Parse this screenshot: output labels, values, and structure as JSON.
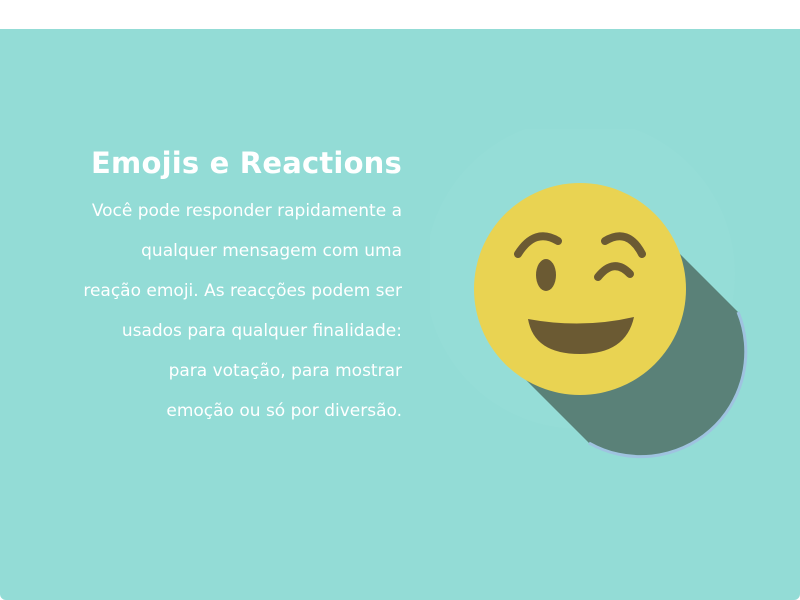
{
  "header": {
    "title": "Emojis e Reactions"
  },
  "description_lines": [
    "Você pode responder rapidamente a",
    "qualquer mensagem com uma",
    "reação emoji. As reacções podem ser",
    "usados para qualquer finalidade:",
    "para votação, para mostrar",
    "emoção ou só por diversão."
  ],
  "illustration": {
    "icon": "winking-face-icon",
    "face_color": "#e9d352",
    "feature_color": "#6b5a33",
    "shadow_color": "#5a8178",
    "background_color": "#93dcd6"
  }
}
